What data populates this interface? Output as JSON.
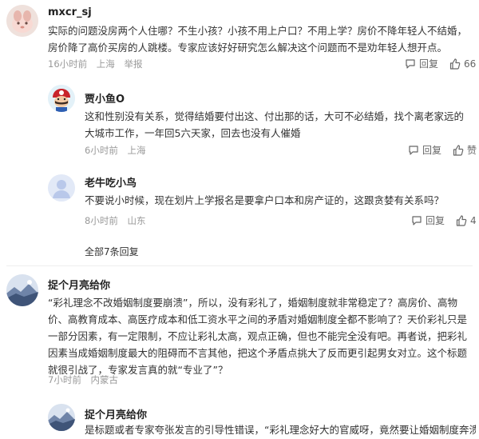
{
  "comments": [
    {
      "username": "mxcr_sj",
      "text": "实际的问题没房两个人住哪？不生小孩？小孩不用上户口？不用上学？房价不降年轻人不结婚，房价降了高价买房的人跳楼。专家应该好好研究怎么解决这个问题而不是劝年轻人想开点。",
      "time": "16小时前",
      "location": "上海",
      "report": "举报",
      "reply_label": "回复",
      "likes": "66"
    },
    {
      "username": "贾小鱼O",
      "text": "这和性别没有关系，觉得结婚要付出这、付出那的话，大可不必结婚，找个离老家远的大城市工作，一年回5六天家，回去也没有人催婚",
      "time": "6小时前",
      "location": "上海",
      "reply_label": "回复",
      "likes": "赞"
    },
    {
      "username": "老牛吃小鸟",
      "text": "不要说小时候，现在划片上学报名是要拿户口本和房产证的，这跟贪婪有关系吗？",
      "time": "8小时前",
      "location": "山东",
      "reply_label": "回复",
      "likes": "4"
    },
    {
      "username": "捉个月亮给你",
      "text": "“彩礼理念不改婚姻制度要崩溃”，所以，没有彩礼了，婚姻制度就非常稳定了？高房价、高物价、高教育成本、高医疗成本和低工资水平之间的矛盾对婚姻制度全都不影响了？天价彩礼只是一部分因素，有一定限制，不应让彩礼太高，观点正确，但也不能完全没有吧。再者说，把彩礼因素当成婚姻制度最大的阻碍而不言其他，把这个矛盾点挑大了反而更引起男女对立。这个标题就很引战了，专家发言真的就“专业了”？",
      "time": "7小时前",
      "location": "内蒙古"
    },
    {
      "username": "捉个月亮给你",
      "text": "是标题或者专家夸张发言的引导性错误，“彩礼理念好大的官威呀，竟然要让婚姻制度奔溃"
    }
  ],
  "more_replies": "全部7条回复",
  "colors": {
    "text": "#333333",
    "meta": "#999999",
    "divider": "#eeeeee"
  },
  "icons": {
    "reply": "speech-bubble-icon",
    "like": "thumbs-up-icon"
  }
}
